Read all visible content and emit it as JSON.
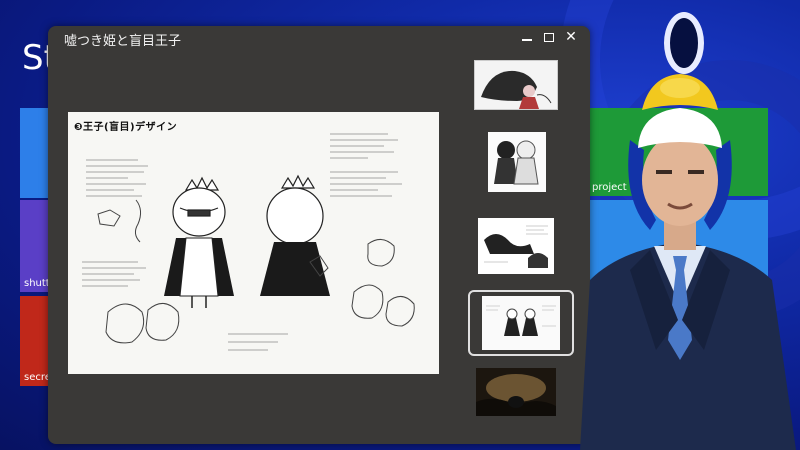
{
  "desktop": {
    "start_title": "St",
    "tiles": {
      "shutter_label": "shutt",
      "secret_label": "secre",
      "project_label": "project"
    },
    "colors": {
      "background": "#102aa8",
      "tile_blue": "#2d7fe9",
      "tile_purple": "#5a3fc6",
      "tile_red": "#c0281a",
      "tile_green": "#1e9a38"
    }
  },
  "window": {
    "title": "嘘つき姫と盲目王子",
    "controls": {
      "minimize_icon": "minimize-icon",
      "maximize_icon": "maximize-icon",
      "close_glyph": "✕"
    },
    "background": "#3a3937"
  },
  "sheet": {
    "title": "❸王子(盲目)デザイン"
  },
  "thumbnails": [
    {
      "icon": "wolf-artwork-thumbnail",
      "selected": false
    },
    {
      "icon": "princess-prince-thumbnail",
      "selected": false
    },
    {
      "icon": "storyboard-thumbnail",
      "selected": false
    },
    {
      "icon": "prince-design-thumbnail",
      "selected": true
    },
    {
      "icon": "forest-scene-thumbnail",
      "selected": false
    }
  ]
}
